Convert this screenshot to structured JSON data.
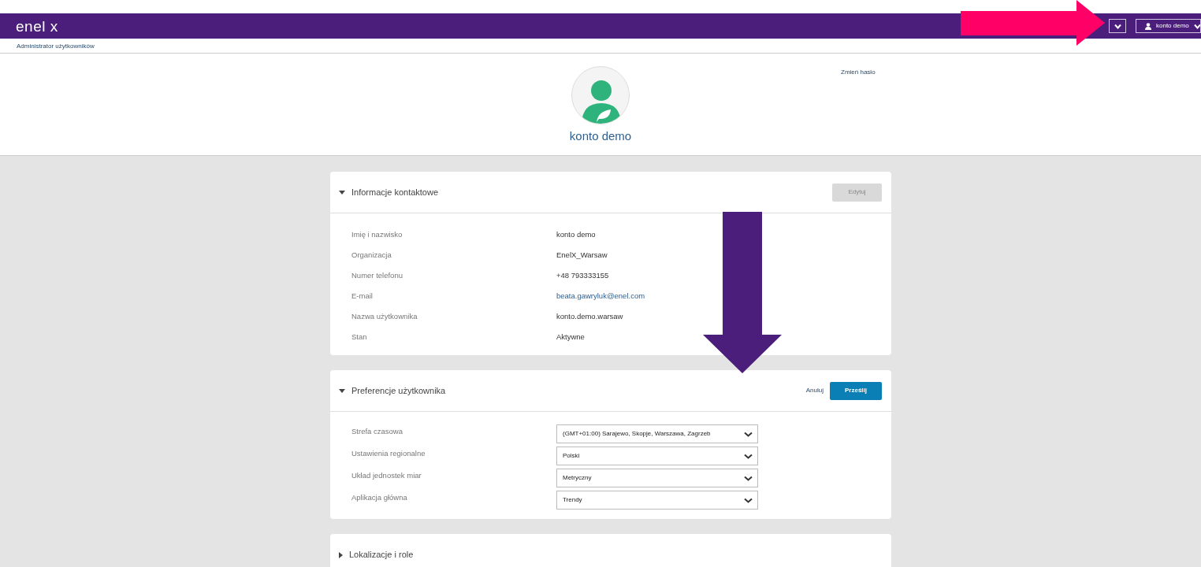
{
  "header": {
    "logo": "enel x",
    "menu_button": {
      "expanded": false
    },
    "user_menu": {
      "label": "konto demo"
    }
  },
  "breadcrumb": "Administrator użytkowników",
  "profile": {
    "name": "konto demo",
    "change_password": "Zmień hasło"
  },
  "sections": [
    {
      "title": "Informacje kontaktowe",
      "expanded": true,
      "buttons": [
        {
          "label": "Edytuj",
          "kind": "secondary",
          "disabled": true
        }
      ],
      "rows": [
        {
          "label": "Imię i nazwisko",
          "value": "konto demo",
          "kind": "text"
        },
        {
          "label": "Organizacja",
          "value": "EnelX_Warsaw",
          "kind": "text"
        },
        {
          "label": "Numer telefonu",
          "value": "+48 793333155",
          "kind": "text"
        },
        {
          "label": "E-mail",
          "value": "beata.gawryluk@enel.com",
          "kind": "link"
        },
        {
          "label": "Nazwa użytkownika",
          "value": "konto.demo.warsaw",
          "kind": "text"
        },
        {
          "label": "Stan",
          "value": "Aktywne",
          "kind": "text"
        }
      ]
    },
    {
      "title": "Preferencje użytkownika",
      "expanded": true,
      "buttons": [
        {
          "label": "Anuluj",
          "kind": "link",
          "disabled": false
        },
        {
          "label": "Prześlij",
          "kind": "primary",
          "disabled": false
        }
      ],
      "rows": [
        {
          "label": "Strefa czasowa",
          "value": "(GMT+01:00) Sarajewo, Skopje, Warszawa, Zagrzeb",
          "kind": "select"
        },
        {
          "label": "Ustawienia regionalne",
          "value": "Polski",
          "kind": "select"
        },
        {
          "label": "Układ jednostek miar",
          "value": "Metryczny",
          "kind": "select"
        },
        {
          "label": "Aplikacja główna",
          "value": "Trendy",
          "kind": "select"
        }
      ]
    },
    {
      "title": "Lokalizacje i role",
      "expanded": false
    }
  ],
  "annotations": [
    {
      "kind": "arrow-right",
      "color": "#ff0066"
    },
    {
      "kind": "arrow-down",
      "color": "#4a1e7a"
    }
  ]
}
